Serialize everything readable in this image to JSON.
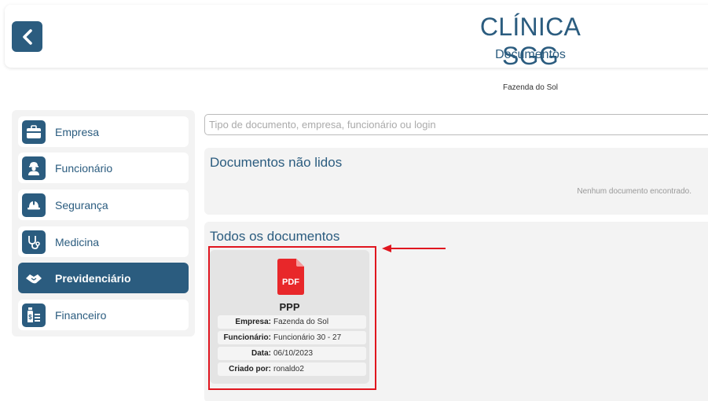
{
  "header": {
    "title": "CLÍNICA SGG",
    "subtitle": "Documentos",
    "company": "Fazenda do Sol"
  },
  "sidebar": {
    "items": [
      {
        "label": "Empresa",
        "icon": "briefcase-icon",
        "active": false
      },
      {
        "label": "Funcionário",
        "icon": "worker-icon",
        "active": false
      },
      {
        "label": "Segurança",
        "icon": "hardhat-icon",
        "active": false
      },
      {
        "label": "Medicina",
        "icon": "stethoscope-icon",
        "active": false
      },
      {
        "label": "Previdenciário",
        "icon": "handshake-icon",
        "active": true
      },
      {
        "label": "Financeiro",
        "icon": "money-icon",
        "active": false
      }
    ]
  },
  "search": {
    "placeholder": "Tipo de documento, empresa, funcionário ou login",
    "value": ""
  },
  "unread": {
    "title": "Documentos não lidos",
    "empty_message": "Nenhum documento encontrado."
  },
  "all_docs": {
    "title": "Todos os documentos",
    "items": [
      {
        "file_badge": "PDF",
        "name": "PPP",
        "fields": [
          {
            "key": "Empresa:",
            "value": "Fazenda do Sol"
          },
          {
            "key": "Funcionário:",
            "value": "Funcionário 30 - 27"
          },
          {
            "key": "Data:",
            "value": "06/10/2023"
          },
          {
            "key": "Criado por:",
            "value": "ronaldo2"
          }
        ]
      }
    ]
  },
  "colors": {
    "primary": "#2b5c7f",
    "pdf": "#e8272a",
    "highlight": "#e0161f"
  }
}
